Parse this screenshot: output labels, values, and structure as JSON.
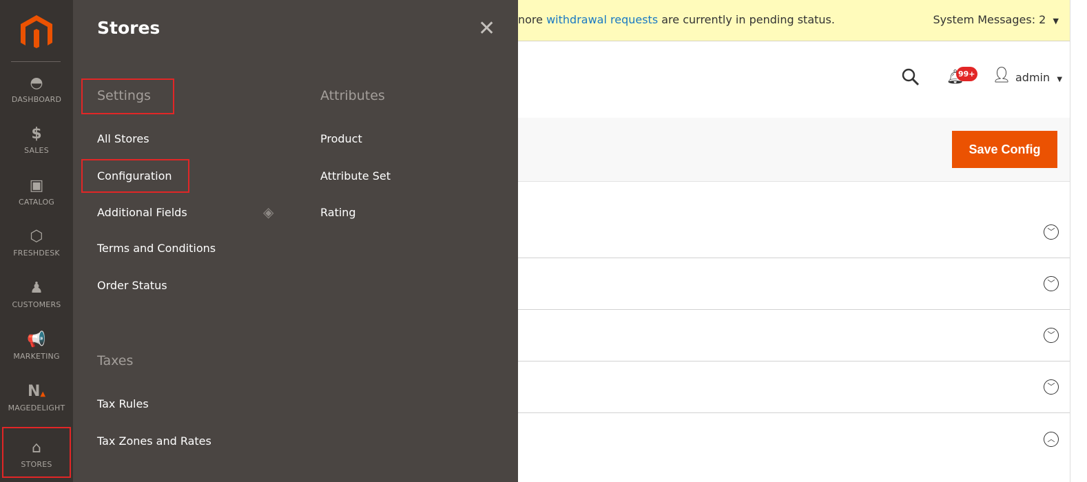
{
  "nav": {
    "items": [
      {
        "label": "DASHBOARD",
        "icon": "gauge-icon"
      },
      {
        "label": "SALES",
        "icon": "dollar-icon"
      },
      {
        "label": "CATALOG",
        "icon": "box-icon"
      },
      {
        "label": "FRESHDESK",
        "icon": "hexagon-icon"
      },
      {
        "label": "CUSTOMERS",
        "icon": "person-icon"
      },
      {
        "label": "MARKETING",
        "icon": "megaphone-icon"
      },
      {
        "label": "MAGEDELIGHT",
        "icon": "magedelight-icon"
      },
      {
        "label": "STORES",
        "icon": "store-icon"
      }
    ]
  },
  "flyout": {
    "title": "Stores",
    "settings": {
      "heading": "Settings",
      "items": [
        "All Stores",
        "Configuration",
        "Additional Fields",
        "Terms and Conditions",
        "Order Status"
      ]
    },
    "taxes": {
      "heading": "Taxes",
      "items": [
        "Tax Rules",
        "Tax Zones and Rates"
      ]
    },
    "attributes": {
      "heading": "Attributes",
      "items": [
        "Product",
        "Attribute Set",
        "Rating"
      ]
    }
  },
  "messages": {
    "prefix": "nore ",
    "link": "withdrawal requests",
    "suffix": " are currently in pending status.",
    "system": "System Messages: 2"
  },
  "header": {
    "notifications": "99+",
    "user": "admin"
  },
  "actions": {
    "save": "Save Config"
  },
  "colors": {
    "accent": "#eb5202",
    "highlight": "#e22626",
    "nav_bg": "#373330",
    "flyout_bg": "#4a4542"
  }
}
